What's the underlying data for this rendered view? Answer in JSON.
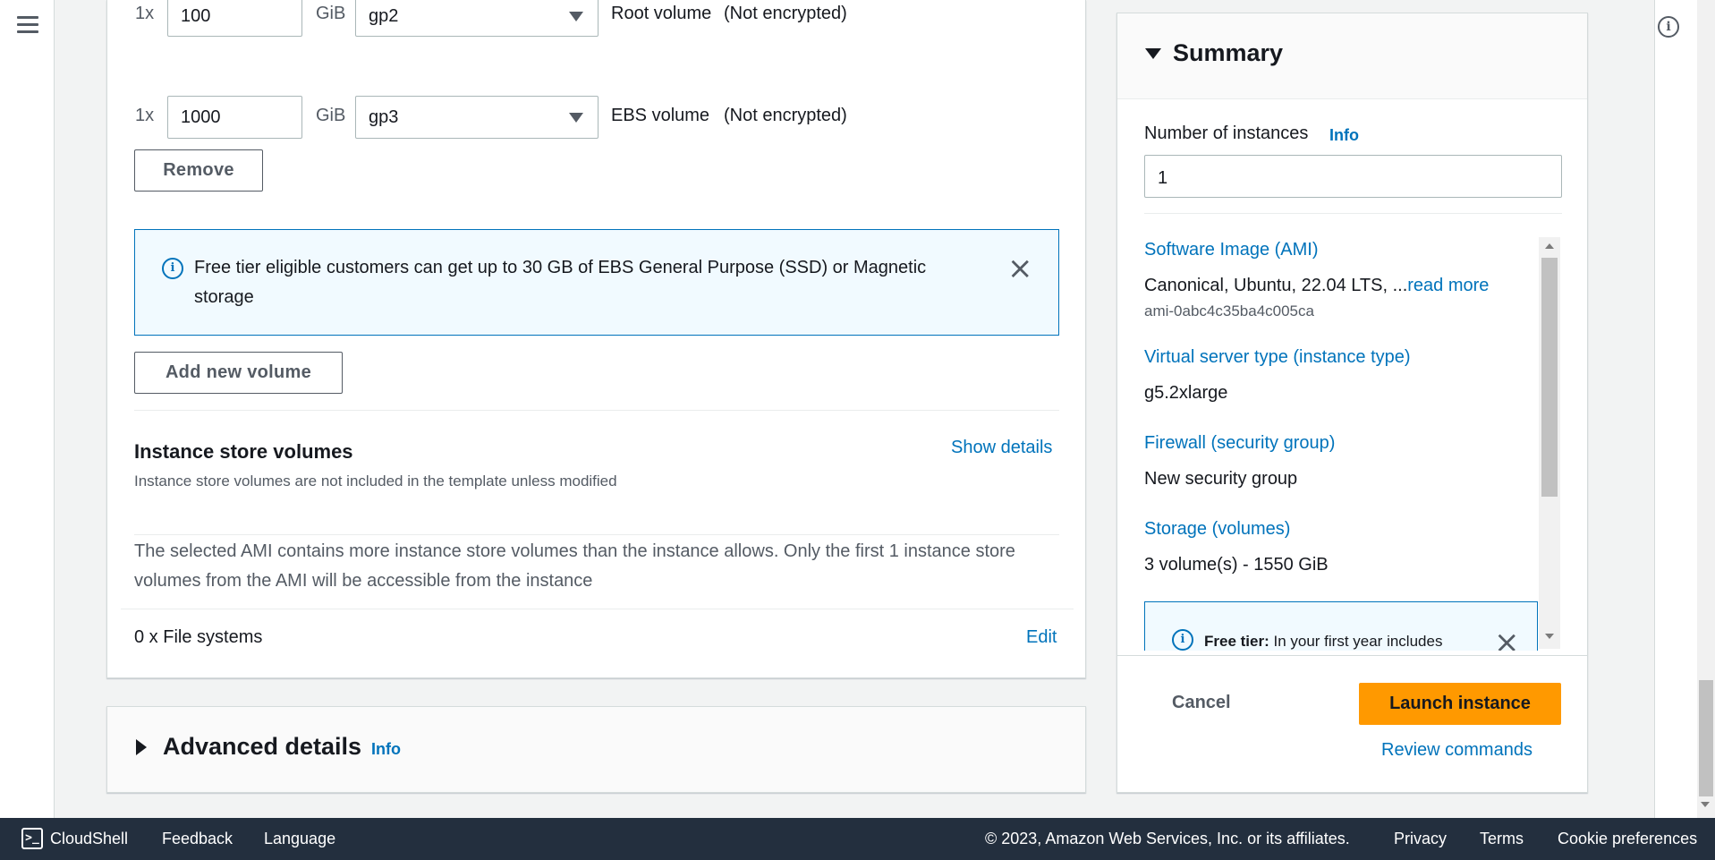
{
  "storage": {
    "volumes": [
      {
        "count": "1x",
        "size": "100",
        "unit": "GiB",
        "type": "gp2",
        "label": "Root volume",
        "encryption": "(Not encrypted)"
      },
      {
        "count": "1x",
        "size": "1000",
        "unit": "GiB",
        "type": "gp3",
        "label": "EBS volume",
        "encryption": "(Not encrypted)"
      }
    ],
    "remove_label": "Remove",
    "free_tier_alert": "Free tier eligible customers can get up to 30 GB of EBS General Purpose (SSD) or Magnetic storage",
    "add_volume_label": "Add new volume",
    "instance_store": {
      "title": "Instance store volumes",
      "subtitle": "Instance store volumes are not included in the template unless modified",
      "show_details": "Show details",
      "note": "The selected AMI contains more instance store volumes than the instance allows. Only the first 1 instance store volumes from the AMI will be accessible from the instance"
    },
    "file_systems": {
      "label": "0 x File systems",
      "edit": "Edit"
    }
  },
  "advanced": {
    "title": "Advanced details",
    "info": "Info"
  },
  "summary": {
    "title": "Summary",
    "num_instances_label": "Number of instances",
    "info": "Info",
    "num_instances_value": "1",
    "ami_title": "Software Image (AMI)",
    "ami_value": "Canonical, Ubuntu, 22.04 LTS, ...",
    "read_more": "read more",
    "ami_id": "ami-0abc4c35ba4c005ca",
    "instance_type_title": "Virtual server type (instance type)",
    "instance_type_value": "g5.2xlarge",
    "firewall_title": "Firewall (security group)",
    "firewall_value": "New security group",
    "storage_title": "Storage (volumes)",
    "storage_value": "3 volume(s) - 1550 GiB",
    "free_tier_bold": "Free tier:",
    "free_tier_text": " In your first year includes",
    "cancel": "Cancel",
    "launch": "Launch instance",
    "review": "Review commands"
  },
  "footer": {
    "cloudshell": "CloudShell",
    "feedback": "Feedback",
    "language": "Language",
    "copyright": "© 2023, Amazon Web Services, Inc. or its affiliates.",
    "privacy": "Privacy",
    "terms": "Terms",
    "cookie": "Cookie preferences"
  },
  "icons": {
    "menu": "hamburger-menu-icon",
    "info": "info-circle-icon",
    "close": "close-icon",
    "expand": "caret-right-icon",
    "collapse": "caret-down-icon",
    "cloudshell": "terminal-icon"
  },
  "colors": {
    "accent": "#0073bb",
    "primary_button": "#ff9900",
    "footer": "#232f3e",
    "alert_bg": "#f1faff"
  }
}
